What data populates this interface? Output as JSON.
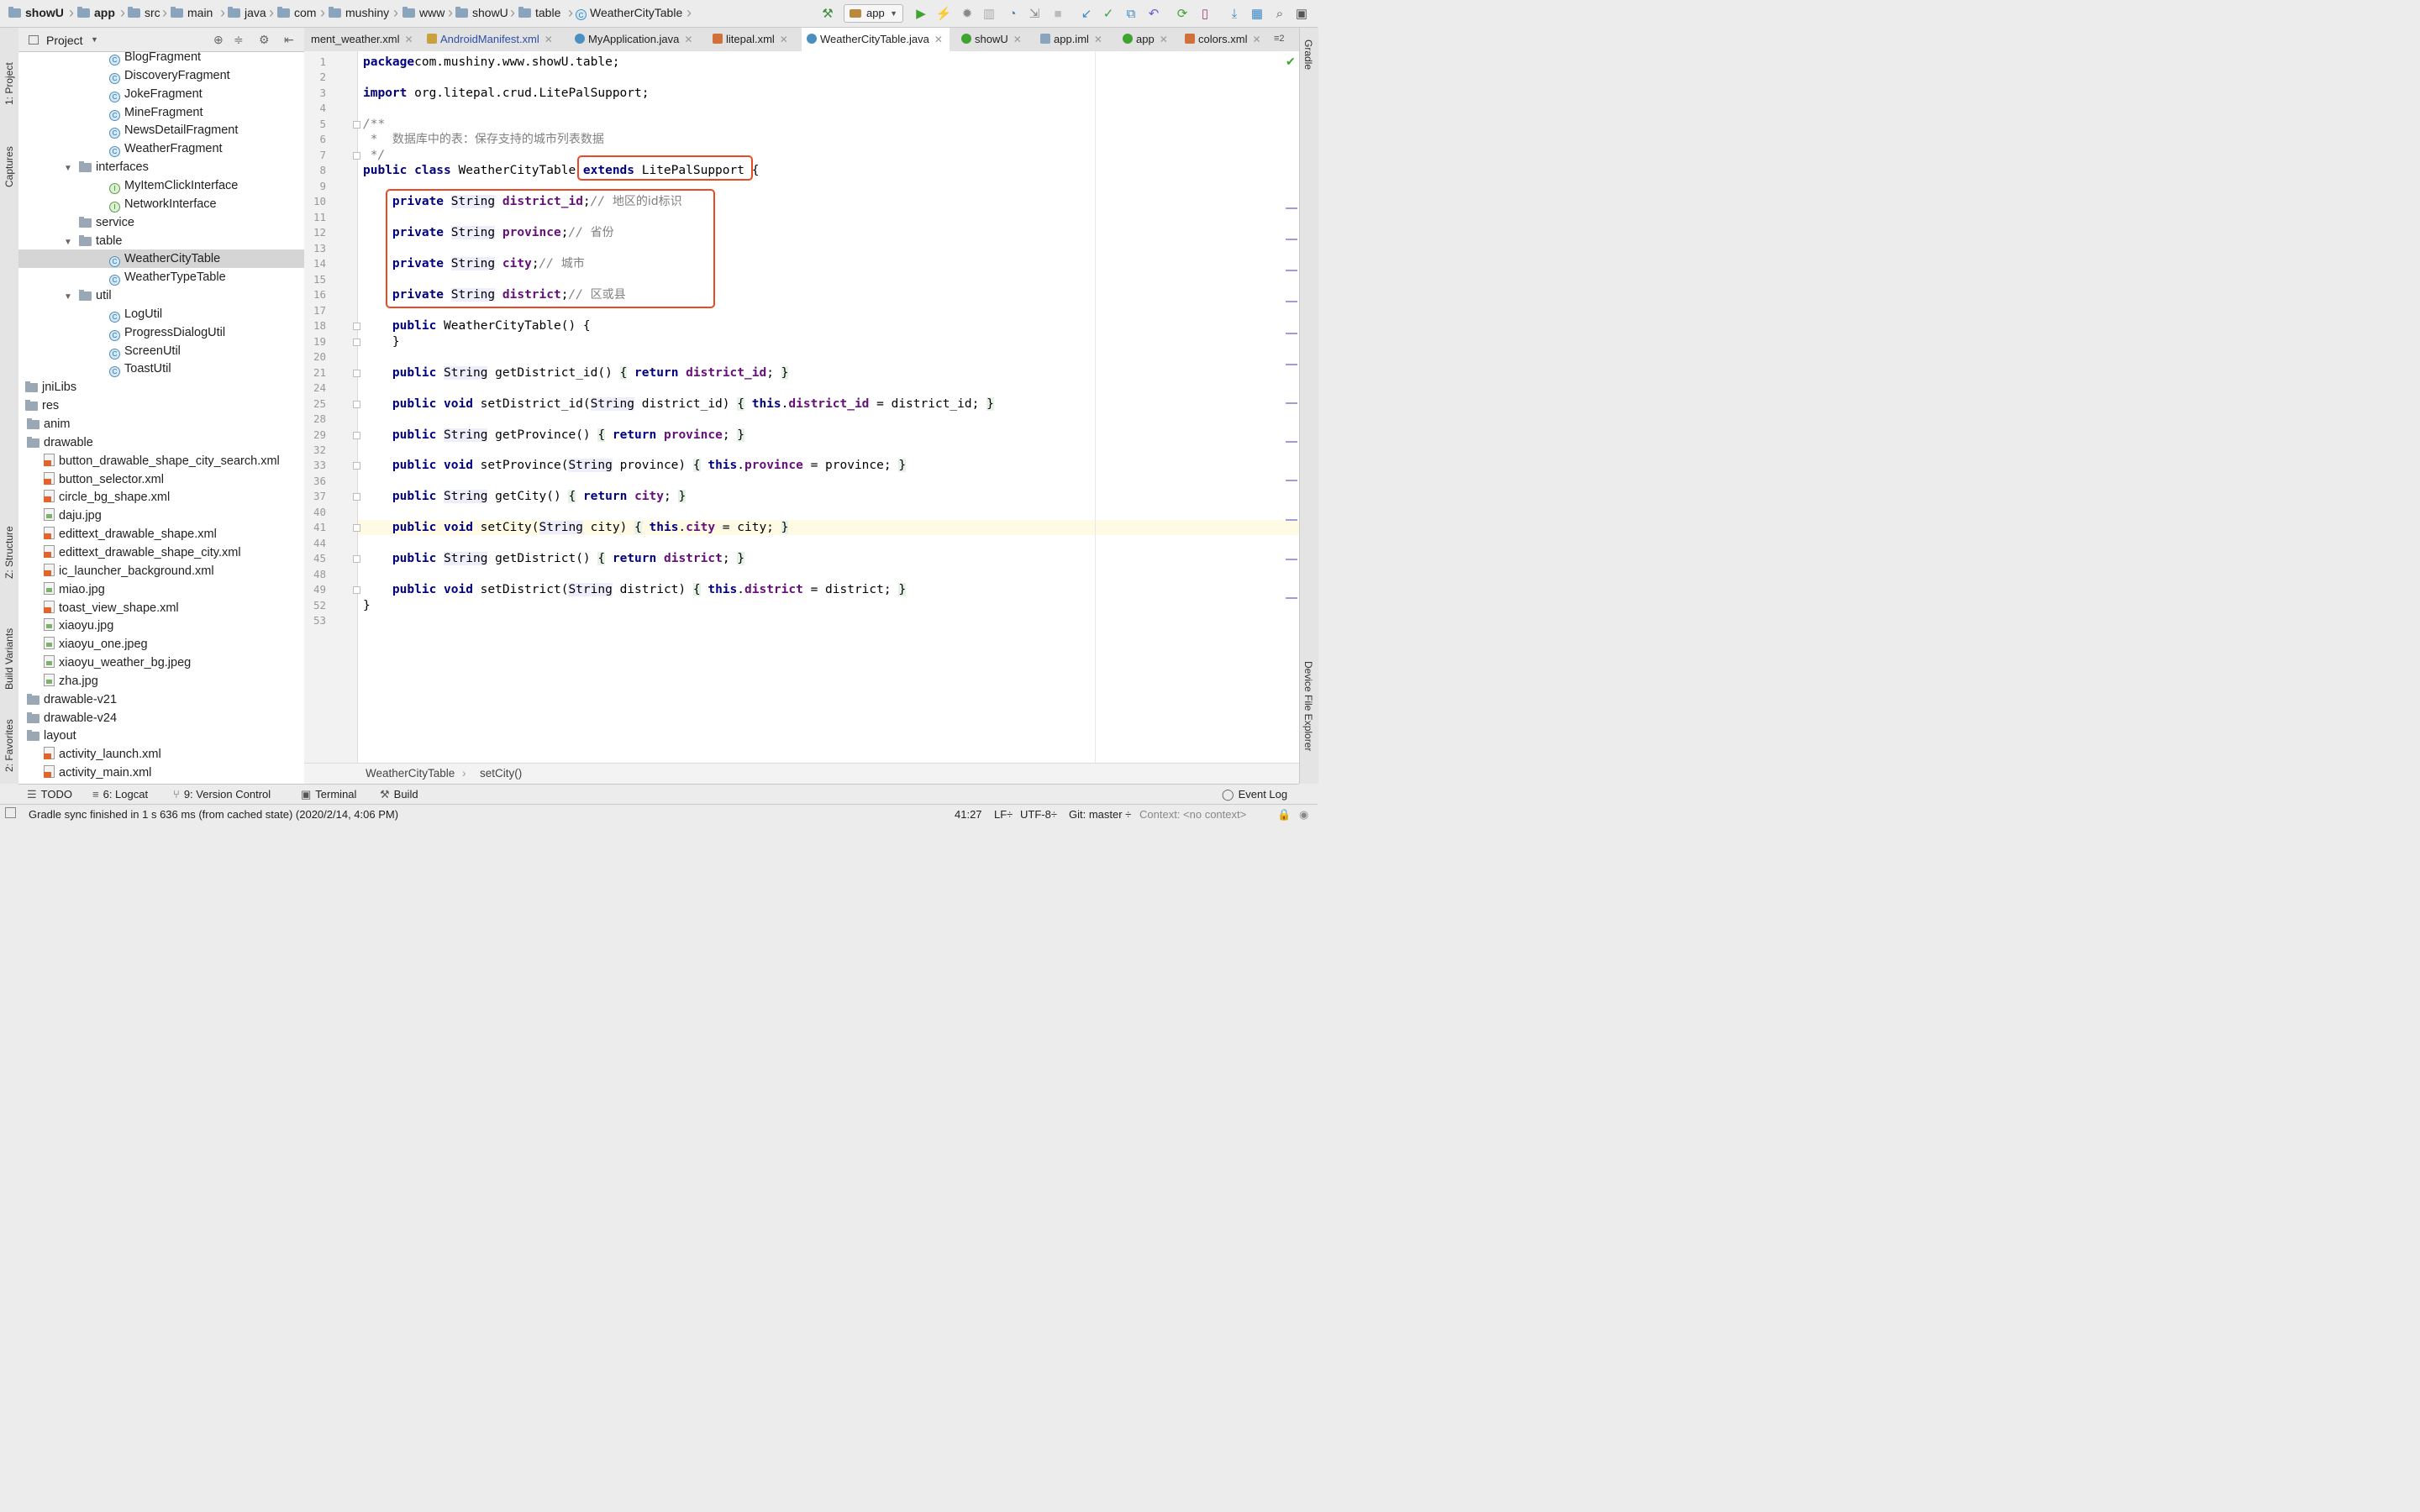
{
  "navbar": {
    "crumbs": [
      "showU",
      "app",
      "src",
      "main",
      "java",
      "com",
      "mushiny",
      "www",
      "showU",
      "table",
      "WeatherCityTable"
    ],
    "run_config": "app"
  },
  "tool_strip": {
    "left": [
      "1: Project",
      "Captures",
      "Z: Structure",
      "Build Variants",
      "2: Favorites"
    ],
    "right": [
      "Gradle",
      "Device File Explorer"
    ]
  },
  "project_panel": {
    "title": "Project",
    "tree": [
      {
        "label": "BlogFragment",
        "icon": "class-icon",
        "indent": 5
      },
      {
        "label": "DiscoveryFragment",
        "icon": "class-icon",
        "indent": 5
      },
      {
        "label": "JokeFragment",
        "icon": "class-icon",
        "indent": 5
      },
      {
        "label": "MineFragment",
        "icon": "class-icon",
        "indent": 5
      },
      {
        "label": "NewsDetailFragment",
        "icon": "class-icon",
        "indent": 5
      },
      {
        "label": "WeatherFragment",
        "icon": "class-icon",
        "indent": 5
      },
      {
        "label": "interfaces",
        "icon": "folder-icon",
        "indent": 4,
        "expanded": true
      },
      {
        "label": "MyItemClickInterface",
        "icon": "interface-icon",
        "indent": 5
      },
      {
        "label": "NetworkInterface",
        "icon": "interface-icon",
        "indent": 5
      },
      {
        "label": "service",
        "icon": "folder-icon",
        "indent": 4
      },
      {
        "label": "table",
        "icon": "folder-icon",
        "indent": 4,
        "expanded": true
      },
      {
        "label": "WeatherCityTable",
        "icon": "class-icon",
        "indent": 5,
        "selected": true
      },
      {
        "label": "WeatherTypeTable",
        "icon": "class-icon",
        "indent": 5
      },
      {
        "label": "util",
        "icon": "folder-icon",
        "indent": 4,
        "expanded": true
      },
      {
        "label": "LogUtil",
        "icon": "class-icon",
        "indent": 5
      },
      {
        "label": "ProgressDialogUtil",
        "icon": "class-icon",
        "indent": 5
      },
      {
        "label": "ScreenUtil",
        "icon": "class-icon",
        "indent": 5
      },
      {
        "label": "ToastUtil",
        "icon": "class-icon",
        "indent": 5
      },
      {
        "label": "jniLibs",
        "icon": "folder-icon",
        "indent": 0
      },
      {
        "label": "res",
        "icon": "folder-icon",
        "indent": 0
      },
      {
        "label": "anim",
        "icon": "folder-icon",
        "indent": 1
      },
      {
        "label": "drawable",
        "icon": "folder-icon",
        "indent": 1
      },
      {
        "label": "button_drawable_shape_city_search.xml",
        "icon": "xml-file-icon",
        "indent": 2
      },
      {
        "label": "button_selector.xml",
        "icon": "xml-file-icon",
        "indent": 2
      },
      {
        "label": "circle_bg_shape.xml",
        "icon": "xml-file-icon",
        "indent": 2
      },
      {
        "label": "daju.jpg",
        "icon": "image-file-icon",
        "indent": 2
      },
      {
        "label": "edittext_drawable_shape.xml",
        "icon": "xml-file-icon",
        "indent": 2
      },
      {
        "label": "edittext_drawable_shape_city.xml",
        "icon": "xml-file-icon",
        "indent": 2
      },
      {
        "label": "ic_launcher_background.xml",
        "icon": "xml-file-icon",
        "indent": 2
      },
      {
        "label": "miao.jpg",
        "icon": "image-file-icon",
        "indent": 2
      },
      {
        "label": "toast_view_shape.xml",
        "icon": "xml-file-icon",
        "indent": 2
      },
      {
        "label": "xiaoyu.jpg",
        "icon": "image-file-icon",
        "indent": 2
      },
      {
        "label": "xiaoyu_one.jpeg",
        "icon": "image-file-icon",
        "indent": 2
      },
      {
        "label": "xiaoyu_weather_bg.jpeg",
        "icon": "image-file-icon",
        "indent": 2
      },
      {
        "label": "zha.jpg",
        "icon": "image-file-icon",
        "indent": 2
      },
      {
        "label": "drawable-v21",
        "icon": "folder-icon",
        "indent": 1
      },
      {
        "label": "drawable-v24",
        "icon": "folder-icon",
        "indent": 1
      },
      {
        "label": "layout",
        "icon": "folder-icon",
        "indent": 1
      },
      {
        "label": "activity_launch.xml",
        "icon": "xml-file-icon",
        "indent": 2
      },
      {
        "label": "activity_main.xml",
        "icon": "xml-file-icon",
        "indent": 2
      }
    ]
  },
  "tabs": [
    {
      "label": "ment_weather.xml",
      "icon": "xml"
    },
    {
      "label": "AndroidManifest.xml",
      "icon": "manifest"
    },
    {
      "label": "MyApplication.java",
      "icon": "class"
    },
    {
      "label": "litepal.xml",
      "icon": "xml"
    },
    {
      "label": "WeatherCityTable.java",
      "icon": "class",
      "active": true
    },
    {
      "label": "showU",
      "icon": "module"
    },
    {
      "label": "app.iml",
      "icon": "iml"
    },
    {
      "label": "app",
      "icon": "module"
    },
    {
      "label": "colors.xml",
      "icon": "xml"
    }
  ],
  "tabs_overflow": "2",
  "editor": {
    "current_line": 41,
    "lines": [
      {
        "n": "1",
        "t": "package",
        "parts": [
          [
            "kw",
            "package"
          ],
          [
            "",
            "com.mushiny.www.showU.table;"
          ]
        ]
      },
      {
        "n": "2",
        "parts": []
      },
      {
        "n": "3",
        "parts": [
          [
            "kw",
            "import"
          ],
          [
            "",
            " org.litepal.crud.LitePalSupport;"
          ]
        ]
      },
      {
        "n": "4",
        "parts": []
      },
      {
        "n": "5",
        "parts": [
          [
            "cmt",
            "/**"
          ]
        ]
      },
      {
        "n": "6",
        "parts": [
          [
            "cmt",
            " *  "
          ],
          [
            "cmtcjk",
            "数据库中的表：保存支持的城市列表数据"
          ]
        ]
      },
      {
        "n": "7",
        "parts": [
          [
            "cmt",
            " */"
          ]
        ]
      },
      {
        "n": "8",
        "parts": [
          [
            "kw",
            "public class"
          ],
          [
            "",
            " WeatherCityTable "
          ],
          [
            "kw",
            "extends"
          ],
          [
            "",
            " LitePalSupport {"
          ]
        ]
      },
      {
        "n": "9",
        "parts": []
      },
      {
        "n": "10",
        "parts": [
          [
            "",
            "    "
          ],
          [
            "kw",
            "private"
          ],
          [
            "",
            " "
          ],
          [
            "typ",
            "String"
          ],
          [
            "",
            " "
          ],
          [
            "fld",
            "district_id"
          ],
          [
            "",
            ";"
          ],
          [
            "cmt",
            "// "
          ],
          [
            "cmtcjk",
            "地区的id标识"
          ]
        ]
      },
      {
        "n": "11",
        "parts": []
      },
      {
        "n": "12",
        "parts": [
          [
            "",
            "    "
          ],
          [
            "kw",
            "private"
          ],
          [
            "",
            " "
          ],
          [
            "typ",
            "String"
          ],
          [
            "",
            " "
          ],
          [
            "fld",
            "province"
          ],
          [
            "",
            ";"
          ],
          [
            "cmt",
            "// "
          ],
          [
            "cmtcjk",
            "省份"
          ]
        ]
      },
      {
        "n": "13",
        "parts": []
      },
      {
        "n": "14",
        "parts": [
          [
            "",
            "    "
          ],
          [
            "kw",
            "private"
          ],
          [
            "",
            " "
          ],
          [
            "typ",
            "String"
          ],
          [
            "",
            " "
          ],
          [
            "fld",
            "city"
          ],
          [
            "",
            ";"
          ],
          [
            "cmt",
            "// "
          ],
          [
            "cmtcjk",
            "城市"
          ]
        ]
      },
      {
        "n": "15",
        "parts": []
      },
      {
        "n": "16",
        "parts": [
          [
            "",
            "    "
          ],
          [
            "kw",
            "private"
          ],
          [
            "",
            " "
          ],
          [
            "typ",
            "String"
          ],
          [
            "",
            " "
          ],
          [
            "fld",
            "district"
          ],
          [
            "",
            ";"
          ],
          [
            "cmt",
            "// "
          ],
          [
            "cmtcjk",
            "区或县"
          ]
        ]
      },
      {
        "n": "17",
        "parts": []
      },
      {
        "n": "18",
        "parts": [
          [
            "",
            "    "
          ],
          [
            "kw",
            "public"
          ],
          [
            "",
            " WeatherCityTable() {"
          ]
        ]
      },
      {
        "n": "19",
        "parts": [
          [
            "",
            "    }"
          ]
        ]
      },
      {
        "n": "20",
        "parts": []
      },
      {
        "n": "21",
        "parts": [
          [
            "",
            "    "
          ],
          [
            "kw",
            "public"
          ],
          [
            "",
            " "
          ],
          [
            "typ",
            "String"
          ],
          [
            "",
            " getDistrict_id() "
          ],
          [
            "brk",
            "{"
          ],
          [
            "",
            " "
          ],
          [
            "kw",
            "return"
          ],
          [
            "",
            " "
          ],
          [
            "fld",
            "district_id"
          ],
          [
            "",
            "; "
          ],
          [
            "brk",
            "}"
          ]
        ]
      },
      {
        "n": "24",
        "parts": []
      },
      {
        "n": "25",
        "parts": [
          [
            "",
            "    "
          ],
          [
            "kw",
            "public void"
          ],
          [
            "",
            " setDistrict_id("
          ],
          [
            "typ",
            "String"
          ],
          [
            "",
            " district_id) "
          ],
          [
            "brk",
            "{"
          ],
          [
            "",
            " "
          ],
          [
            "kw",
            "this"
          ],
          [
            "",
            "."
          ],
          [
            "fld",
            "district_id"
          ],
          [
            "",
            " = district_id; "
          ],
          [
            "brk",
            "}"
          ]
        ]
      },
      {
        "n": "28",
        "parts": []
      },
      {
        "n": "29",
        "parts": [
          [
            "",
            "    "
          ],
          [
            "kw",
            "public"
          ],
          [
            "",
            " "
          ],
          [
            "typ",
            "String"
          ],
          [
            "",
            " getProvince() "
          ],
          [
            "brk",
            "{"
          ],
          [
            "",
            " "
          ],
          [
            "kw",
            "return"
          ],
          [
            "",
            " "
          ],
          [
            "fld",
            "province"
          ],
          [
            "",
            "; "
          ],
          [
            "brk",
            "}"
          ]
        ]
      },
      {
        "n": "32",
        "parts": []
      },
      {
        "n": "33",
        "parts": [
          [
            "",
            "    "
          ],
          [
            "kw",
            "public void"
          ],
          [
            "",
            " setProvince("
          ],
          [
            "typ",
            "String"
          ],
          [
            "",
            " province) "
          ],
          [
            "brk",
            "{"
          ],
          [
            "",
            " "
          ],
          [
            "kw",
            "this"
          ],
          [
            "",
            "."
          ],
          [
            "fld",
            "province"
          ],
          [
            "",
            " = province; "
          ],
          [
            "brk",
            "}"
          ]
        ]
      },
      {
        "n": "36",
        "parts": []
      },
      {
        "n": "37",
        "parts": [
          [
            "",
            "    "
          ],
          [
            "kw",
            "public"
          ],
          [
            "",
            " "
          ],
          [
            "typ",
            "String"
          ],
          [
            "",
            " getCity() "
          ],
          [
            "brk",
            "{"
          ],
          [
            "",
            " "
          ],
          [
            "kw",
            "return"
          ],
          [
            "",
            " "
          ],
          [
            "fld",
            "city"
          ],
          [
            "",
            "; "
          ],
          [
            "brk",
            "}"
          ]
        ]
      },
      {
        "n": "40",
        "parts": []
      },
      {
        "n": "41",
        "parts": [
          [
            "",
            "    "
          ],
          [
            "kw",
            "public void"
          ],
          [
            "",
            " setCity("
          ],
          [
            "typ",
            "String"
          ],
          [
            "",
            " city) "
          ],
          [
            "brk",
            "{"
          ],
          [
            "",
            " "
          ],
          [
            "kw",
            "this"
          ],
          [
            "",
            "."
          ],
          [
            "fld",
            "city"
          ],
          [
            "",
            " = city; "
          ],
          [
            "brk",
            "}"
          ]
        ]
      },
      {
        "n": "44",
        "parts": []
      },
      {
        "n": "45",
        "parts": [
          [
            "",
            "    "
          ],
          [
            "kw",
            "public"
          ],
          [
            "",
            " "
          ],
          [
            "typ",
            "String"
          ],
          [
            "",
            " getDistrict() "
          ],
          [
            "brk",
            "{"
          ],
          [
            "",
            " "
          ],
          [
            "kw",
            "return"
          ],
          [
            "",
            " "
          ],
          [
            "fld",
            "district"
          ],
          [
            "",
            "; "
          ],
          [
            "brk",
            "}"
          ]
        ]
      },
      {
        "n": "48",
        "parts": []
      },
      {
        "n": "49",
        "parts": [
          [
            "",
            "    "
          ],
          [
            "kw",
            "public void"
          ],
          [
            "",
            " setDistrict("
          ],
          [
            "typ",
            "String"
          ],
          [
            "",
            " district) "
          ],
          [
            "brk",
            "{"
          ],
          [
            "",
            " "
          ],
          [
            "kw",
            "this"
          ],
          [
            "",
            "."
          ],
          [
            "fld",
            "district"
          ],
          [
            "",
            " = district; "
          ],
          [
            "brk",
            "}"
          ]
        ]
      },
      {
        "n": "52",
        "parts": [
          [
            "",
            "}"
          ]
        ]
      },
      {
        "n": "53",
        "parts": []
      }
    ]
  },
  "editor_breadcrumb": [
    "WeatherCityTable",
    "setCity()"
  ],
  "bottom_tools": [
    {
      "label": "TODO"
    },
    {
      "label": "6: Logcat"
    },
    {
      "label": "9: Version Control"
    },
    {
      "label": "Terminal"
    },
    {
      "label": "Build"
    }
  ],
  "event_log": "Event Log",
  "status": {
    "message": "Gradle sync finished in 1 s 636 ms (from cached state) (2020/2/14, 4:06 PM)",
    "position": "41:27",
    "line_sep": "LF÷",
    "encoding": "UTF-8÷",
    "git": "Git: master ÷",
    "context": "Context: <no context>"
  },
  "colors": {
    "highlight_box": "#e94a24",
    "keyword": "#000080",
    "field": "#660e7a",
    "comment": "#808080"
  }
}
